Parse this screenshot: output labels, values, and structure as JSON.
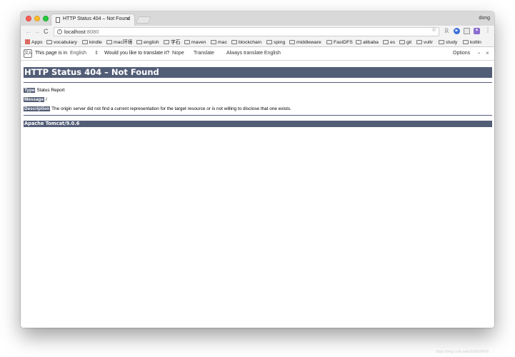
{
  "browser": {
    "profile_name": "dong",
    "tab": {
      "title": "HTTP Status 404 – Not Found",
      "close": "×"
    },
    "toolbar": {
      "url_host": "localhost",
      "url_port": ":8080",
      "back": "←",
      "forward": "→",
      "reload": "C",
      "star": "☆",
      "menu": "⋮"
    },
    "bookmarks": [
      "Apps",
      "vocabulary",
      "kindle",
      "mac环境",
      "english",
      "字石",
      "maven",
      "mac",
      "blockchain",
      "sping",
      "middleware",
      "FastDFS",
      "alibaba",
      "es",
      "git",
      "vultr",
      "study",
      "kotlin"
    ],
    "translate_bar": {
      "prefix": "This page is in",
      "language": "English",
      "question": "Would you like to translate it?",
      "nope": "Nope",
      "translate": "Translate",
      "always": "Always translate English",
      "options": "Options",
      "close": "×"
    }
  },
  "page": {
    "title": "HTTP Status 404 – Not Found",
    "type_label": "Type",
    "type_value": "Status Report",
    "message_label": "Message",
    "message_value": "/",
    "description_label": "Description",
    "description_value": "The origin server did not find a current representation for the target resource or is not willing to disclose that one exists.",
    "server": "Apache Tomcat/9.0.6"
  },
  "watermark": "https://blog.csdn.net/u010928478",
  "colors": {
    "tomcat_header": "#525d76",
    "tab_strip": "#d9d9d9",
    "toolbar": "#f3f3f3"
  }
}
